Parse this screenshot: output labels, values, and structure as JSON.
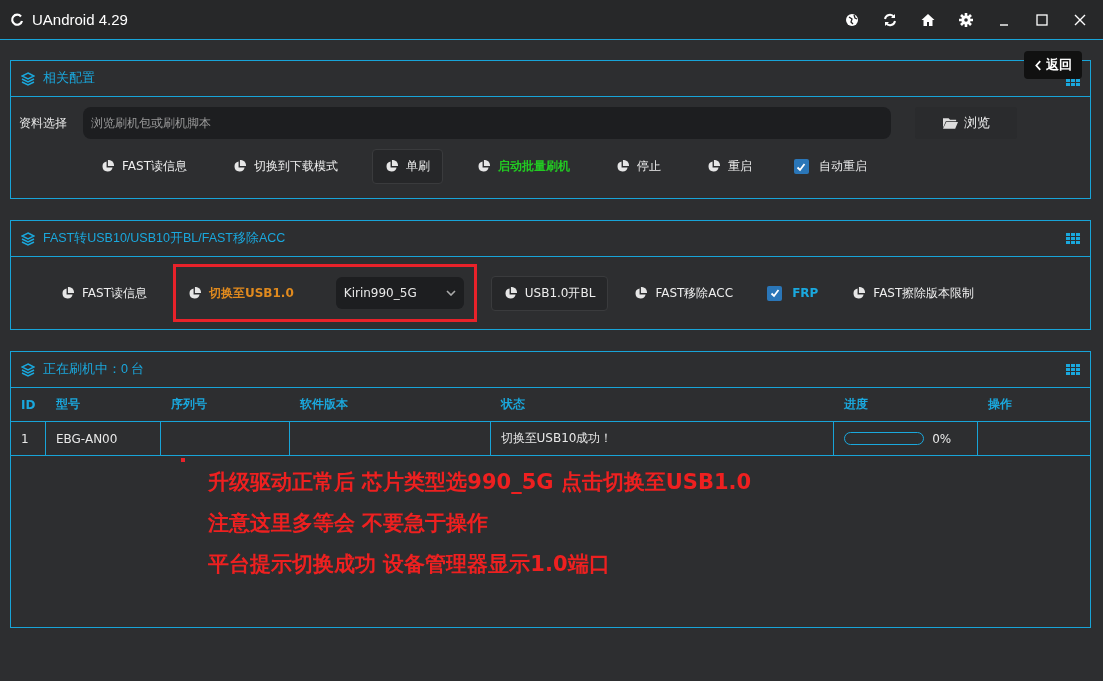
{
  "window": {
    "title": "UAndroid 4.29"
  },
  "back_button": {
    "label": "返回"
  },
  "config_panel": {
    "title": "相关配置",
    "file_label": "资料选择",
    "file_field": {
      "placeholder": "浏览刷机包或刷机脚本"
    },
    "browse_button": {
      "label": "浏览"
    },
    "actions": [
      {
        "kind": "button",
        "label": "FAST读信息",
        "framed": false
      },
      {
        "kind": "button",
        "label": "切换到下载模式",
        "framed": false
      },
      {
        "kind": "button",
        "label": "单刷",
        "framed": true
      },
      {
        "kind": "button",
        "label": "启动批量刷机",
        "framed": false,
        "color": "#22cc22"
      },
      {
        "kind": "button",
        "label": "停止",
        "framed": false
      },
      {
        "kind": "button",
        "label": "重启",
        "framed": false
      },
      {
        "kind": "checkbox",
        "label": "自动重启",
        "checked": true
      }
    ]
  },
  "usb_panel": {
    "title": "FAST转USB10/USB10开BL/FAST移除ACC",
    "actions": [
      {
        "kind": "button",
        "label": "FAST读信息",
        "framed": false
      },
      {
        "kind": "highlight",
        "children": [
          {
            "kind": "button",
            "label": "切换至USB1.0",
            "framed": false,
            "color": "#e08a1e"
          },
          {
            "kind": "dropdown",
            "value": "Kirin990_5G"
          }
        ]
      },
      {
        "kind": "button",
        "label": "USB1.0开BL",
        "framed": true
      },
      {
        "kind": "button",
        "label": "FAST移除ACC",
        "framed": false
      },
      {
        "kind": "checkbox",
        "label": "FRP",
        "checked": true
      },
      {
        "kind": "button",
        "label": "FAST擦除版本限制",
        "framed": false
      }
    ]
  },
  "device_panel": {
    "title": "正在刷机中：0 台",
    "table": {
      "columns": [
        "ID",
        "型号",
        "序列号",
        "软件版本",
        "状态",
        "进度",
        "操作"
      ],
      "rows": [
        {
          "id": "1",
          "model": "EBG-AN00",
          "status": "切换至USB10成功！",
          "progress": {
            "level": 0,
            "reading": "0%"
          }
        }
      ]
    },
    "annotations": [
      "升级驱动正常后 芯片类型选990_5G 点击切换至USB1.0",
      "注意这里多等会 不要急于操作",
      "平台提示切换成功 设备管理器显示1.0端口"
    ]
  }
}
